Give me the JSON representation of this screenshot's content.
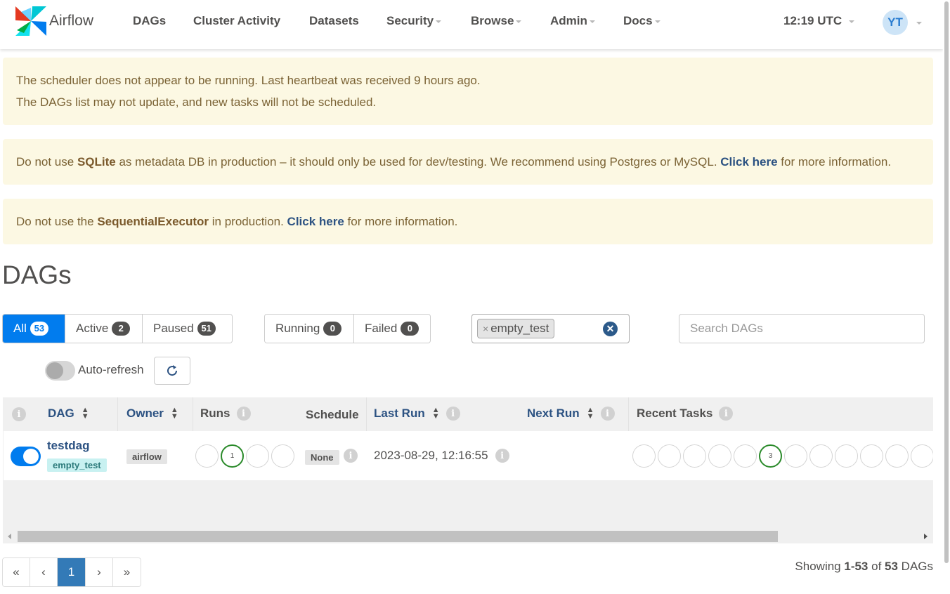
{
  "navbar": {
    "brand": "Airflow",
    "items": [
      {
        "label": "DAGs",
        "dropdown": false
      },
      {
        "label": "Cluster Activity",
        "dropdown": false
      },
      {
        "label": "Datasets",
        "dropdown": false
      },
      {
        "label": "Security",
        "dropdown": true
      },
      {
        "label": "Browse",
        "dropdown": true
      },
      {
        "label": "Admin",
        "dropdown": true
      },
      {
        "label": "Docs",
        "dropdown": true
      }
    ],
    "time": "12:19 UTC",
    "user_initials": "YT"
  },
  "alerts": {
    "scheduler_line1": "The scheduler does not appear to be running. Last heartbeat was received 9 hours ago.",
    "scheduler_line2": "The DAGs list may not update, and new tasks will not be scheduled.",
    "sqlite_pre": "Do not use ",
    "sqlite_bold": "SQLite",
    "sqlite_mid": " as metadata DB in production – it should only be used for dev/testing. We recommend using Postgres or MySQL. ",
    "sqlite_link": "Click here",
    "sqlite_post": " for more information.",
    "executor_pre": "Do not use the ",
    "executor_bold": "SequentialExecutor",
    "executor_mid": " in production. ",
    "executor_link": "Click here",
    "executor_post": " for more information."
  },
  "page_title": "DAGs",
  "filters": {
    "all_label": "All",
    "all_count": "53",
    "active_label": "Active",
    "active_count": "2",
    "paused_label": "Paused",
    "paused_count": "51",
    "running_label": "Running",
    "running_count": "0",
    "failed_label": "Failed",
    "failed_count": "0",
    "tag_value": "empty_test",
    "search_placeholder": "Search DAGs"
  },
  "auto_refresh_label": "Auto-refresh",
  "table": {
    "headers": {
      "dag": "DAG",
      "owner": "Owner",
      "runs": "Runs",
      "schedule": "Schedule",
      "last_run": "Last Run",
      "next_run": "Next Run",
      "recent_tasks": "Recent Tasks"
    },
    "rows": [
      {
        "dag_id": "testdag",
        "tag": "empty_test",
        "owner": "airflow",
        "runs_success": "1",
        "schedule": "None",
        "last_run": "2023-08-29, 12:16:55",
        "recent_tasks_success": "3"
      }
    ]
  },
  "pagination": {
    "first": "«",
    "prev": "‹",
    "current": "1",
    "next": "›",
    "last": "»"
  },
  "showing": {
    "pre": "Showing ",
    "range": "1-53",
    "mid": " of ",
    "total": "53",
    "post": " DAGs"
  },
  "colors": {
    "accent": "#017cee",
    "link": "#2c5282",
    "success": "#2a8a2a",
    "alert_bg": "#fcf8e3"
  }
}
